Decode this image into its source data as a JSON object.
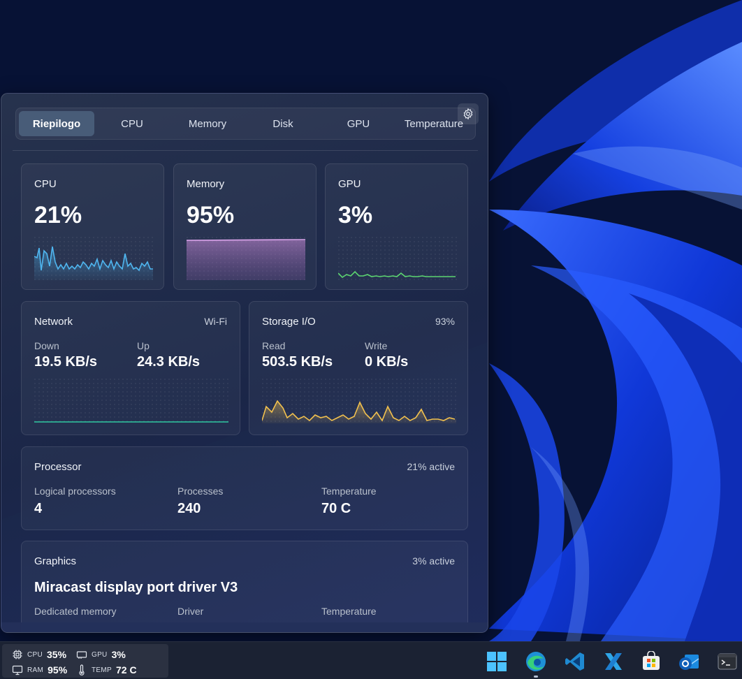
{
  "tabs": [
    "Riepilogo",
    "CPU",
    "Memory",
    "Disk",
    "GPU",
    "Temperature"
  ],
  "active_tab": "Riepilogo",
  "cpu_card": {
    "title": "CPU",
    "value": "21%",
    "color": "#4fb6f0"
  },
  "memory_card": {
    "title": "Memory",
    "value": "95%",
    "color": "#c88ad8"
  },
  "gpu_card": {
    "title": "GPU",
    "value": "3%",
    "color": "#5cd670"
  },
  "network": {
    "title": "Network",
    "connection": "Wi-Fi",
    "down_label": "Down",
    "down_value": "19.5 KB/s",
    "up_label": "Up",
    "up_value": "24.3 KB/s",
    "color": "#2ec7a0"
  },
  "storage": {
    "title": "Storage I/O",
    "usage": "93%",
    "read_label": "Read",
    "read_value": "503.5 KB/s",
    "write_label": "Write",
    "write_value": "0 KB/s",
    "color": "#f2c14e"
  },
  "processor": {
    "title": "Processor",
    "status": "21% active",
    "logical_label": "Logical processors",
    "logical_value": "4",
    "processes_label": "Processes",
    "processes_value": "240",
    "temp_label": "Temperature",
    "temp_value": "70 C"
  },
  "graphics": {
    "title": "Graphics",
    "status": "3% active",
    "name": "Miracast display port driver V3",
    "dedicated_label": "Dedicated memory",
    "driver_label": "Driver",
    "temp_label": "Temperature"
  },
  "taskbar": {
    "cpu_label": "CPU",
    "cpu_value": "35%",
    "gpu_label": "GPU",
    "gpu_value": "3%",
    "ram_label": "RAM",
    "ram_value": "95%",
    "temp_label": "TEMP",
    "temp_value": "72 C",
    "apps": [
      "start-icon",
      "edge-icon",
      "vscode-icon",
      "xaml-studio-icon",
      "store-icon",
      "outlook-icon",
      "terminal-icon"
    ]
  }
}
